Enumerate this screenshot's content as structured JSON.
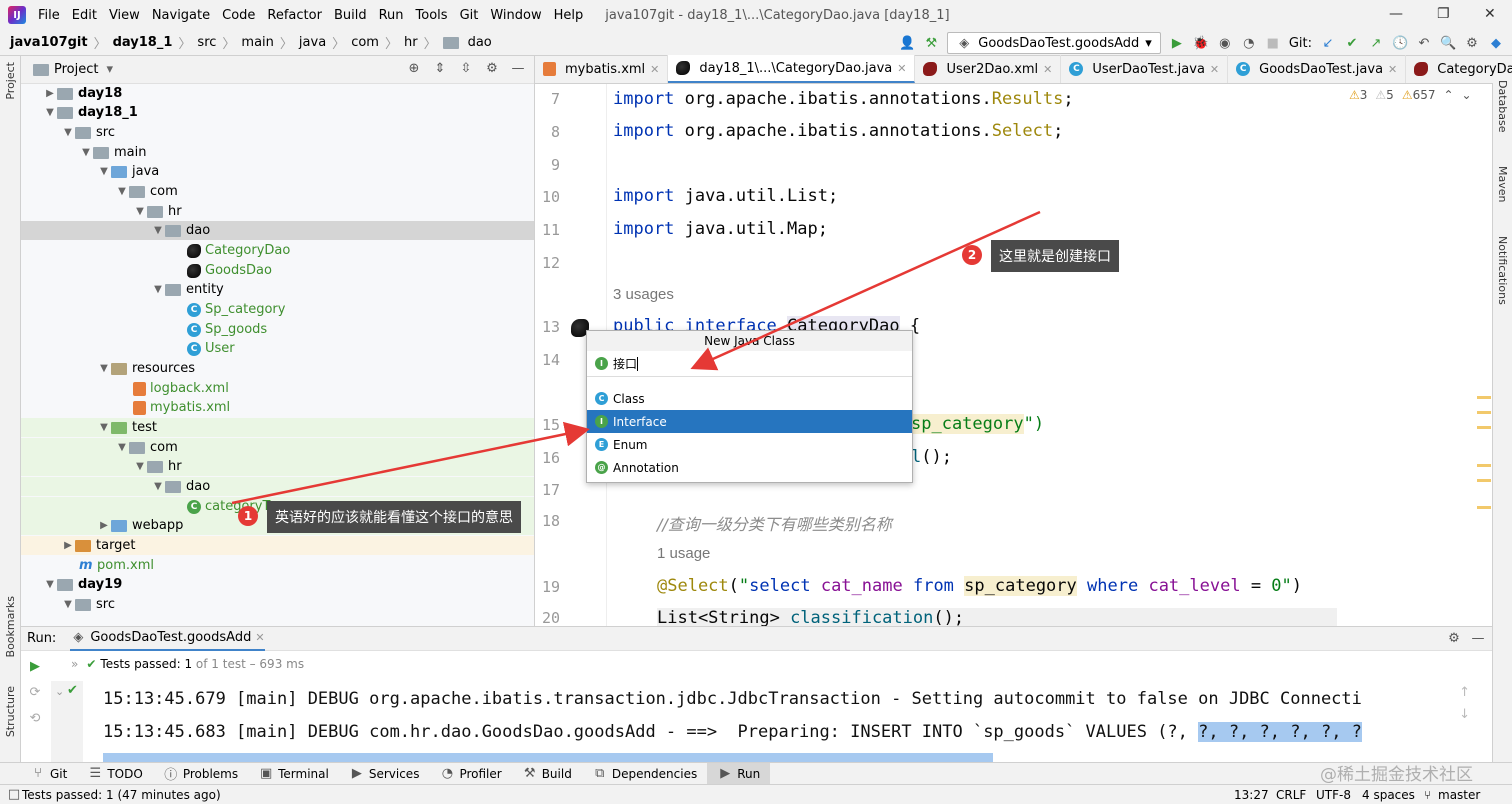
{
  "menubar": {
    "items": [
      "File",
      "Edit",
      "View",
      "Navigate",
      "Code",
      "Refactor",
      "Build",
      "Run",
      "Tools",
      "Git",
      "Window",
      "Help"
    ],
    "window_title": "java107git - day18_1\\...\\CategoryDao.java [day18_1]"
  },
  "breadcrumb": [
    "java107git",
    "day18_1",
    "src",
    "main",
    "java",
    "com",
    "hr",
    "dao"
  ],
  "toolbar": {
    "run_config": "GoodsDaoTest.goodsAdd",
    "git_label": "Git:"
  },
  "left_strip": {
    "project": "Project",
    "bookmarks": "Bookmarks",
    "structure": "Structure"
  },
  "right_strip": {
    "database": "Database",
    "maven": "Maven",
    "notifications": "Notifications"
  },
  "project": {
    "title": "Project",
    "tree": [
      {
        "label": "day18",
        "bold": true
      },
      {
        "label": "day18_1",
        "bold": true
      },
      {
        "label": "src"
      },
      {
        "label": "main"
      },
      {
        "label": "java"
      },
      {
        "label": "com"
      },
      {
        "label": "hr"
      },
      {
        "label": "dao"
      },
      {
        "label": "CategoryDao"
      },
      {
        "label": "GoodsDao"
      },
      {
        "label": "entity"
      },
      {
        "label": "Sp_category"
      },
      {
        "label": "Sp_goods"
      },
      {
        "label": "User"
      },
      {
        "label": "resources"
      },
      {
        "label": "logback.xml"
      },
      {
        "label": "mybatis.xml"
      },
      {
        "label": "test"
      },
      {
        "label": "com"
      },
      {
        "label": "hr"
      },
      {
        "label": "dao"
      },
      {
        "label": "categoryTe"
      },
      {
        "label": "webapp"
      },
      {
        "label": "target"
      },
      {
        "label": "pom.xml"
      },
      {
        "label": "day19",
        "bold": true
      },
      {
        "label": "src"
      }
    ]
  },
  "tabs": [
    "mybatis.xml",
    "day18_1\\...\\CategoryDao.java",
    "User2Dao.xml",
    "UserDaoTest.java",
    "GoodsDaoTest.java",
    "CategoryDao.xml"
  ],
  "inspections": {
    "warn1": "3",
    "warn2": "5",
    "warn3": "657"
  },
  "editor": {
    "lines": [
      {
        "n": "7",
        "text": "import org.apache.ibatis.annotations.Results;"
      },
      {
        "n": "8",
        "text": "import org.apache.ibatis.annotations.Select;"
      },
      {
        "n": "9",
        "text": ""
      },
      {
        "n": "10",
        "text": "import java.util.List;"
      },
      {
        "n": "11",
        "text": "import java.util.Map;"
      },
      {
        "n": "12",
        "text": ""
      },
      {
        "n": "13",
        "text": "public interface CategoryDao {"
      },
      {
        "n": "14",
        "text": ""
      },
      {
        "n": "15",
        "text": "sp_category\")"
      },
      {
        "n": "16",
        "text": "l();"
      },
      {
        "n": "17",
        "text": ""
      },
      {
        "n": "18",
        "text": "//查询一级分类下有哪些类别名称"
      },
      {
        "n": "19",
        "text": "@Select(\"select cat_name from sp_category where cat_level = 0\")"
      },
      {
        "n": "20",
        "text": "List<String> classification();"
      }
    ],
    "usages1": "3 usages",
    "usages2": "1 usage"
  },
  "popup": {
    "title": "New Java Class",
    "input": "接口",
    "items": [
      "Class",
      "Interface",
      "Enum",
      "Annotation"
    ]
  },
  "callouts": {
    "c1_num": "1",
    "c1_text": "英语好的应该就能看懂这个接口的意思",
    "c2_num": "2",
    "c2_text": "这里就是创建接口"
  },
  "run": {
    "label": "Run:",
    "tab": "GoodsDaoTest.goodsAdd",
    "status_prefix": "Tests passed:",
    "status_count": "1",
    "status_rest": "of 1 test – 693 ms",
    "log1": "15:13:45.679 [main] DEBUG org.apache.ibatis.transaction.jdbc.JdbcTransaction - Setting autocommit to false on JDBC Connecti",
    "log2a": "15:13:45.683 [main] DEBUG com.hr.dao.GoodsDao.goodsAdd - ==>  Preparing: INSERT INTO `sp_goods` VALUES (?, ",
    "log2b": "?, ?, ?, ?, ?, ?"
  },
  "bottom_tools": [
    "Git",
    "TODO",
    "Problems",
    "Terminal",
    "Services",
    "Profiler",
    "Build",
    "Dependencies",
    "Run"
  ],
  "status": {
    "left": "Tests passed: 1 (47 minutes ago)",
    "pos": "13:27",
    "eol": "CRLF",
    "enc": "UTF-8",
    "indent": "4 spaces",
    "branch": "master",
    "watermark": "@稀土掘金技术社区"
  }
}
